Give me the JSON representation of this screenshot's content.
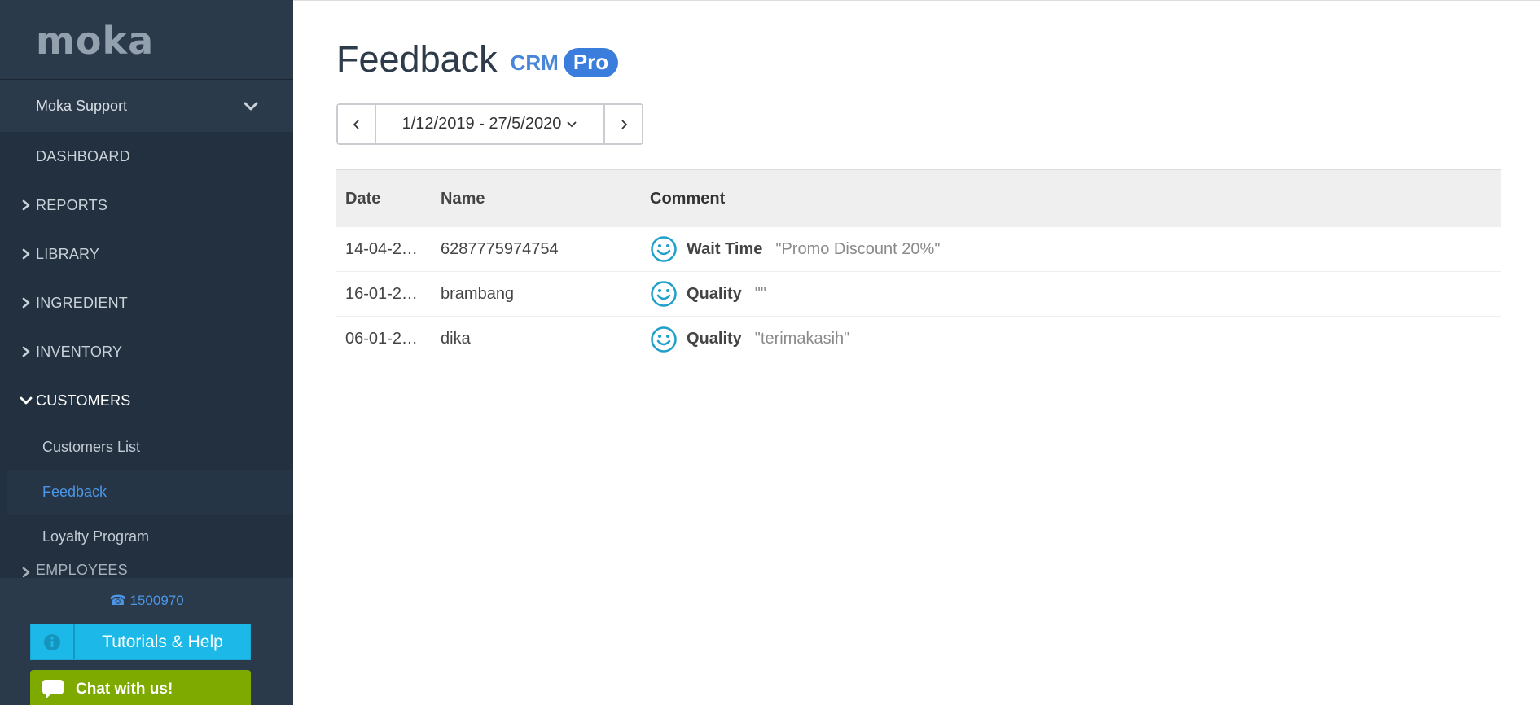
{
  "brand": {
    "logo": "moka"
  },
  "account": {
    "name": "Moka Support"
  },
  "nav": {
    "dashboard": "DASHBOARD",
    "reports": "REPORTS",
    "library": "LIBRARY",
    "ingredient": "INGREDIENT",
    "inventory": "INVENTORY",
    "customers": "CUSTOMERS",
    "customers_sub": [
      "Customers List",
      "Feedback",
      "Loyalty Program"
    ],
    "employees_partial": "EMPLOYEES"
  },
  "footer": {
    "phone": "1500970",
    "help_label": "Tutorials & Help",
    "chat_label": "Chat with us!"
  },
  "page": {
    "title": "Feedback",
    "crm": "CRM",
    "pro": "Pro",
    "date_range": "1/12/2019 - 27/5/2020"
  },
  "table": {
    "headers": [
      "Date",
      "Name",
      "Comment"
    ],
    "rows": [
      {
        "date": "14-04-2…",
        "name": "6287775974754",
        "category": "Wait Time",
        "comment": "\"Promo Discount 20%\""
      },
      {
        "date": "16-01-2…",
        "name": "brambang",
        "category": "Quality",
        "comment": "\"\""
      },
      {
        "date": "06-01-2…",
        "name": "dika",
        "category": "Quality",
        "comment": "\"terimakasih\""
      }
    ]
  },
  "colors": {
    "sidebar": "#22303f",
    "active_link": "#4c96e8",
    "help_button": "#1cb8e8",
    "chat_button": "#7eaa00",
    "smile_icon": "#1ea0c8"
  }
}
